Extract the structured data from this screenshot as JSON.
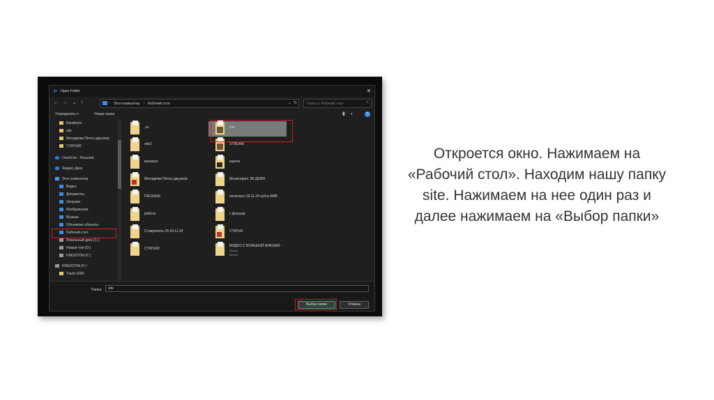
{
  "dialog": {
    "title": "Open Folder",
    "address": {
      "segments": [
        "Этот компьютер",
        "Рабочий стол"
      ]
    },
    "search": {
      "placeholder": "Поиск в: Рабочий стол"
    },
    "toolbar": {
      "organize": "Упорядочить ▾",
      "new_folder": "Новая папка"
    },
    "sidebar": [
      {
        "label": "Bandicam",
        "icon": "folder-icon"
      },
      {
        "label": "site",
        "icon": "folder-icon"
      },
      {
        "label": "Методички Питон джуниор",
        "icon": "folder-icon"
      },
      {
        "label": "СТАТЬЯ2",
        "icon": "folder-icon"
      },
      {
        "label": "OneDrive - Personal",
        "icon": "cloud-icon"
      },
      {
        "label": "Яндекс.Диск",
        "icon": "cloud-icon"
      },
      {
        "label": "Этот компьютер",
        "icon": "computer-icon"
      },
      {
        "label": "Видео",
        "icon": "video-icon"
      },
      {
        "label": "Документы",
        "icon": "documents-icon"
      },
      {
        "label": "Загрузки",
        "icon": "download-icon"
      },
      {
        "label": "Изображения",
        "icon": "pictures-icon"
      },
      {
        "label": "Музыка",
        "icon": "music-icon"
      },
      {
        "label": "Объемные объекты",
        "icon": "3d-icon"
      },
      {
        "label": "Рабочий стол",
        "icon": "desktop-icon"
      },
      {
        "label": "Локальный диск (C:)",
        "icon": "drive-icon"
      },
      {
        "label": "Новый том (D:)",
        "icon": "drive-icon"
      },
      {
        "label": "KINGSTON (F:)",
        "icon": "drive-icon"
      },
      {
        "label": "KINGSTON (F:)",
        "icon": "drive-icon"
      },
      {
        "label": "Trash-1000",
        "icon": "folder-icon"
      }
    ],
    "files": [
      {
        "label": ".vs",
        "icon": "folder-icon"
      },
      {
        "label": "site",
        "icon": "folder-photo-icon"
      },
      {
        "label": "site2",
        "icon": "folder-icon"
      },
      {
        "label": "STREAM",
        "icon": "folder-photo-icon"
      },
      {
        "label": "выписки",
        "icon": "folder-icon"
      },
      {
        "label": "карега",
        "icon": "folder-dark-icon"
      },
      {
        "label": "Методички Питон джуниор",
        "icon": "folder-red-icon"
      },
      {
        "label": "Мониторинг 3В ДЕМО",
        "icon": "folder-icon"
      },
      {
        "label": "ПАСКАЛЬ",
        "icon": "folder-icon"
      },
      {
        "label": "пятигорск 03.11.24 кубок КМВ",
        "icon": "folder-icon"
      },
      {
        "label": "работа",
        "icon": "folder-icon"
      },
      {
        "label": "с флешки",
        "icon": "folder-icon"
      },
      {
        "label": "Ставрополь 23-24.11.24",
        "icon": "folder-icon"
      },
      {
        "label": "СТАТЬЯ",
        "icon": "folder-red-icon"
      },
      {
        "label": "СТАТЬЯ2",
        "icon": "folder-icon"
      },
      {
        "label": "ВИДЕО С БОЛЬШОЙ ФЛЕШКИ -",
        "icon": "folder-shortcut-icon",
        "sub1": "Ярлык",
        "sub2": "Ярлык"
      }
    ],
    "folder_label": "Папка:",
    "folder_value": "site",
    "buttons": {
      "select": "Выбор папки",
      "cancel": "Отмена"
    }
  },
  "caption": "Откроется окно. Нажимаем на «Рабочий стол». Находим нашу папку site. Нажимаем на нее один раз и далее нажимаем на «Выбор папки»",
  "colors": {
    "accent": "#3c8ce7",
    "highlight": "#d11f1f",
    "folder": "#e8c46a"
  }
}
